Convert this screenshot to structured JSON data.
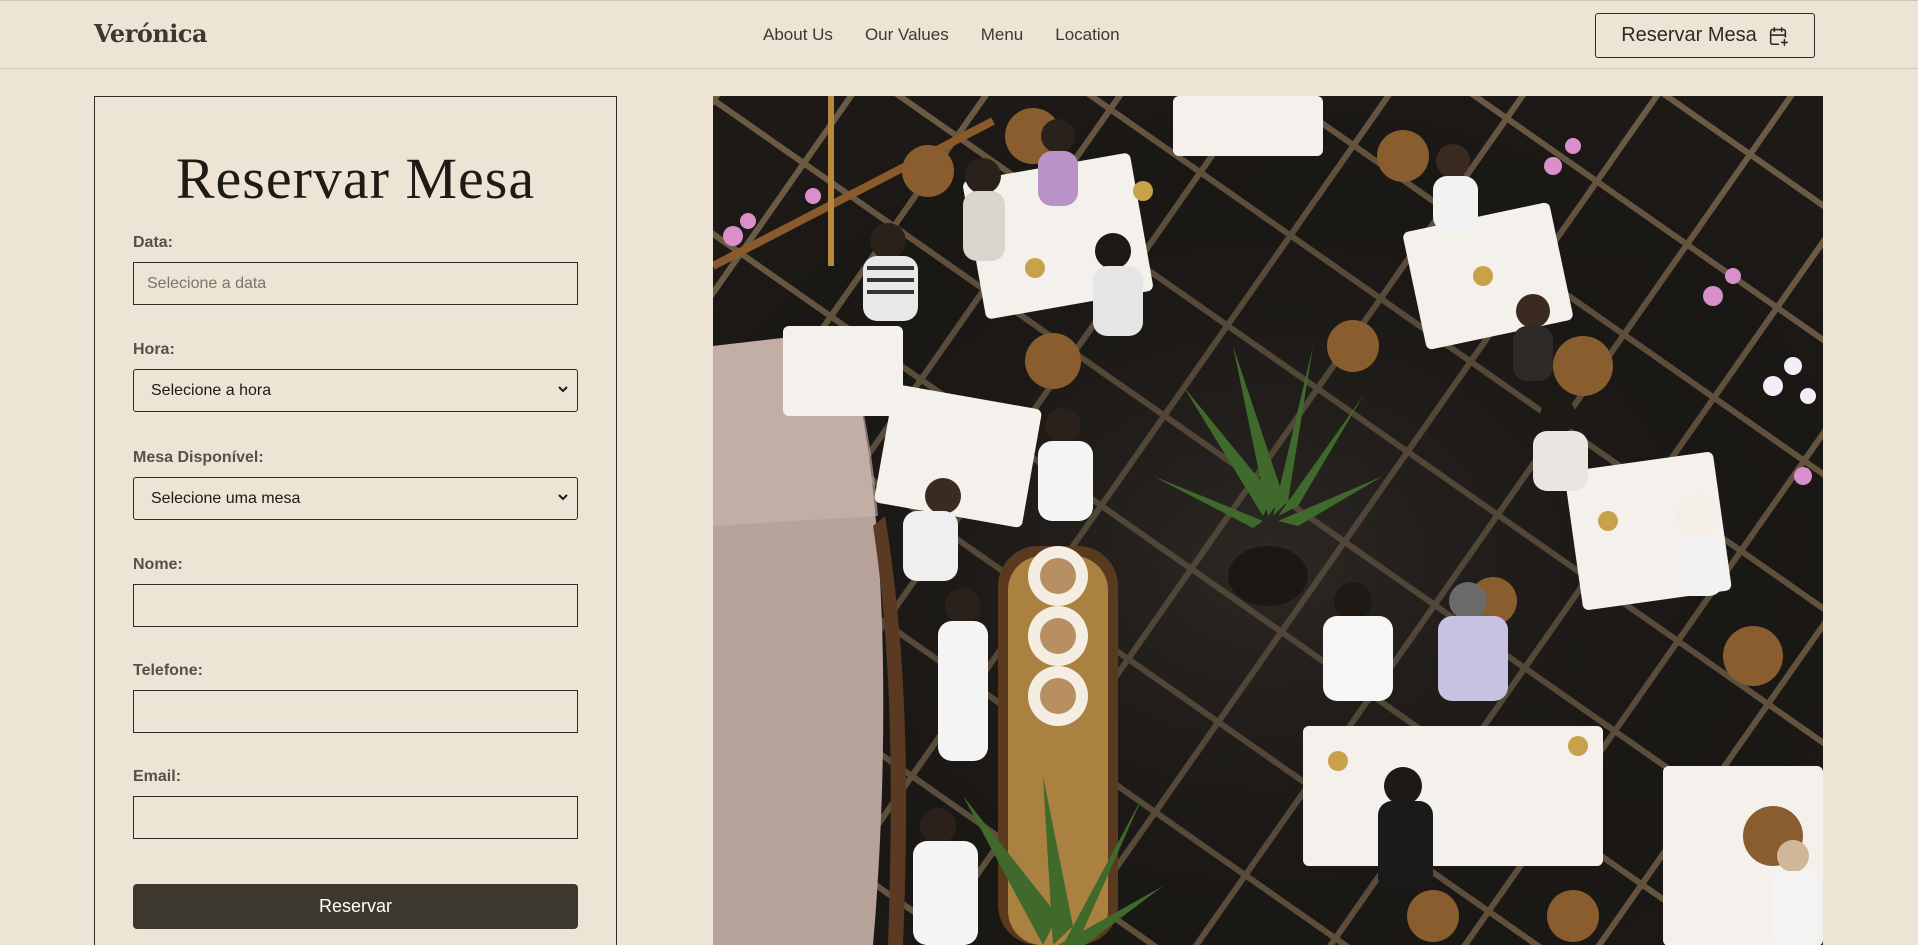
{
  "brand": "Verónica",
  "nav": [
    "About Us",
    "Our Values",
    "Menu",
    "Location"
  ],
  "header_button": {
    "label": "Reservar Mesa",
    "icon": "calendar-plus-icon"
  },
  "form": {
    "title": "Reservar Mesa",
    "fields": [
      {
        "label": "Data:",
        "type": "date",
        "placeholder": "Selecione a data",
        "value": ""
      },
      {
        "label": "Hora:",
        "type": "select",
        "value": "Selecione a hora"
      },
      {
        "label": "Mesa Disponível:",
        "type": "select",
        "value": "Selecione uma mesa"
      },
      {
        "label": "Nome:",
        "type": "text",
        "value": ""
      },
      {
        "label": "Telefone:",
        "type": "text",
        "value": ""
      },
      {
        "label": "Email:",
        "type": "text",
        "value": ""
      }
    ],
    "submit": "Reservar"
  },
  "colors": {
    "background": "#ede4d6",
    "accent": "#3d382d",
    "text": "#2f2a22"
  }
}
